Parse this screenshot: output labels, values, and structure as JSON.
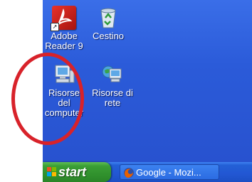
{
  "desktop": {
    "icons": [
      {
        "label": "Adobe Reader 9",
        "icon": "adobe-reader-icon"
      },
      {
        "label": "Cestino",
        "icon": "recycle-bin-icon"
      },
      {
        "label": "Risorse del computer",
        "icon": "my-computer-icon"
      },
      {
        "label": "Risorse di rete",
        "icon": "network-places-icon"
      }
    ]
  },
  "taskbar": {
    "start_label": "start",
    "tasks": [
      {
        "label": "Google - Mozi...",
        "icon": "firefox-icon"
      }
    ]
  },
  "annotation": {
    "color": "#d8222a"
  },
  "colors": {
    "desktop": "#2b5bd9",
    "taskbar": "#2257d3",
    "start": "#3a9e35"
  }
}
